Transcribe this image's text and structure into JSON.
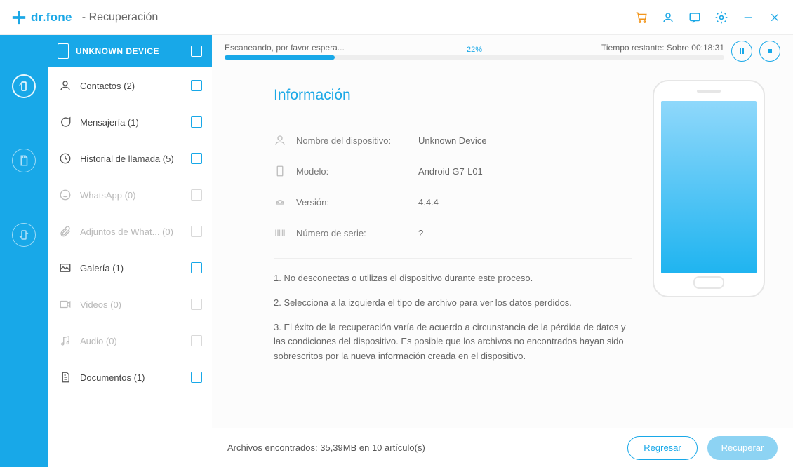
{
  "app": {
    "name": "dr.fone",
    "module": "Recuperación"
  },
  "rail": {
    "active": 0
  },
  "device": {
    "label": "UNKNOWN DEVICE"
  },
  "categories": [
    {
      "key": "contacts",
      "label": "Contactos (2)",
      "dim": false
    },
    {
      "key": "messages",
      "label": "Mensajería (1)",
      "dim": false
    },
    {
      "key": "calls",
      "label": "Historial de llamada (5)",
      "dim": false
    },
    {
      "key": "whatsapp",
      "label": "WhatsApp (0)",
      "dim": true
    },
    {
      "key": "waattach",
      "label": "Adjuntos de What... (0)",
      "dim": true
    },
    {
      "key": "gallery",
      "label": "Galería (1)",
      "dim": false
    },
    {
      "key": "videos",
      "label": "Videos (0)",
      "dim": true
    },
    {
      "key": "audio",
      "label": "Audio (0)",
      "dim": true
    },
    {
      "key": "docs",
      "label": "Documentos (1)",
      "dim": false
    }
  ],
  "scan": {
    "status": "Escaneando, por favor espera...",
    "time_label": "Tiempo restante: Sobre 00:18:31",
    "percent_text": "22%",
    "percent": 22
  },
  "info": {
    "title": "Información",
    "rows": {
      "name": {
        "label": "Nombre del dispositivo:",
        "value": "Unknown Device"
      },
      "model": {
        "label": "Modelo:",
        "value": "Android G7-L01"
      },
      "version": {
        "label": "Versión:",
        "value": "4.4.4"
      },
      "serial": {
        "label": "Número de serie:",
        "value": "?"
      }
    },
    "notes": {
      "n1": "1. No desconectas o utilizas el dispositivo durante este proceso.",
      "n2": "2. Selecciona a la izquierda el tipo de archivo para ver los datos perdidos.",
      "n3": "3. El éxito de la recuperación varía de acuerdo a circunstancia de la pérdida de datos y las condiciones del dispositivo. Es posible que los archivos no encontrados hayan sido sobrescritos por la nueva información creada en el dispositivo."
    }
  },
  "footer": {
    "found": "Archivos encontrados:  35,39MB en 10 artículo(s)",
    "back": "Regresar",
    "recover": "Recuperar"
  }
}
